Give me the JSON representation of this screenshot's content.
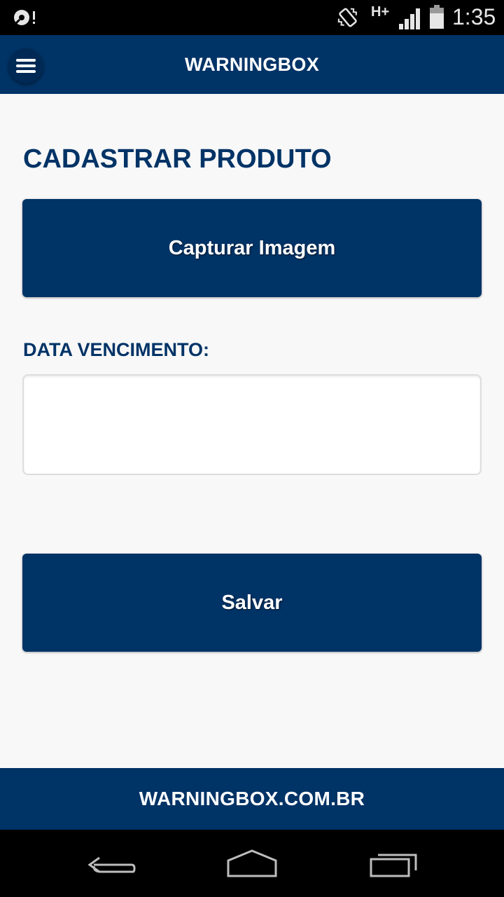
{
  "status_bar": {
    "left_icon": "sync-icon",
    "vibrate_icon": "vibrate-icon",
    "network_type": "H+",
    "signal_icon": "signal-icon",
    "battery_icon": "battery-icon",
    "time": "1:35"
  },
  "app_bar": {
    "menu_icon": "hamburger-menu-icon",
    "title": "WARNINGBOX"
  },
  "main": {
    "page_title": "CADASTRAR PRODUTO",
    "capture_button_label": "Capturar Imagem",
    "date_label": "DATA VENCIMENTO:",
    "date_value": "",
    "save_button_label": "Salvar"
  },
  "footer": {
    "text": "WARNINGBOX.COM.BR"
  },
  "nav_bar": {
    "back_icon": "back-icon",
    "home_icon": "home-icon",
    "recents_icon": "recents-icon"
  },
  "colors": {
    "primary": "#003366",
    "background": "#f8f8f8"
  }
}
